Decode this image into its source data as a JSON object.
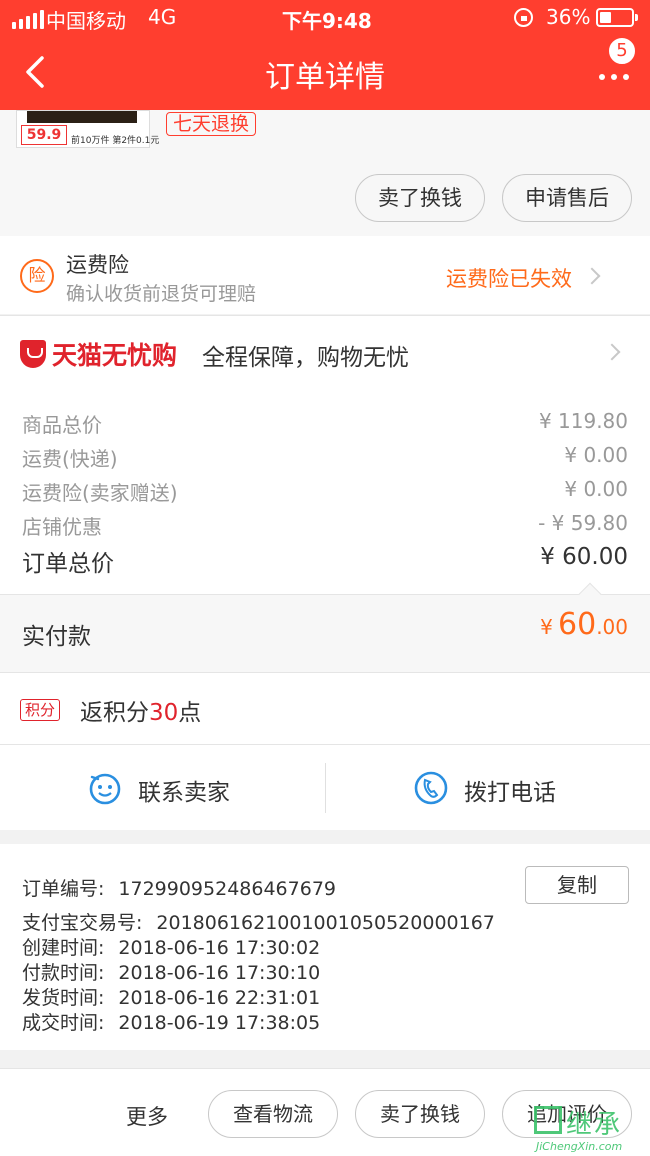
{
  "status_bar": {
    "carrier": "中国移动",
    "network": "4G",
    "time": "下午9:48",
    "battery_pct": "36%",
    "battery_level": 0.36
  },
  "header": {
    "title": "订单详情",
    "more_badge": "5"
  },
  "product": {
    "thumb_price": "59.9",
    "thumb_promo": "前10万件 第2件0.1元",
    "return_tag": "七天退换",
    "actions": [
      "卖了换钱",
      "申请售后"
    ]
  },
  "insurance": {
    "icon_char": "险",
    "title": "运费险",
    "subtitle": "确认收货前退货可理赔",
    "status": "运费险已失效"
  },
  "tmall": {
    "brand": "天猫无忧购",
    "slogan": "全程保障，购物无忧"
  },
  "price_breakdown": [
    {
      "label": "商品总价",
      "value": "¥ 119.80"
    },
    {
      "label": "运费(快递)",
      "value": "¥ 0.00"
    },
    {
      "label": "运费险(卖家赠送)",
      "value": "¥ 0.00"
    },
    {
      "label": "店铺优惠",
      "value": "- ¥ 59.80"
    }
  ],
  "order_total": {
    "label": "订单总价",
    "value": "¥ 60.00"
  },
  "paid": {
    "label": "实付款",
    "currency": "¥",
    "integer": "60",
    "decimal": ".00"
  },
  "points": {
    "tag": "积分",
    "prefix": "返积分",
    "amount": "30",
    "suffix": "点"
  },
  "contact": {
    "seller": "联系卖家",
    "phone": "拨打电话"
  },
  "order_info": {
    "copy_label": "复制",
    "rows": [
      {
        "key": "订单编号:",
        "value": "172990952486467679"
      },
      {
        "key": "支付宝交易号:",
        "value": "2018061621001001050520000167"
      },
      {
        "key": "创建时间:",
        "value": "2018-06-16 17:30:02"
      },
      {
        "key": "付款时间:",
        "value": "2018-06-16 17:30:10"
      },
      {
        "key": "发货时间:",
        "value": "2018-06-16 22:31:01"
      },
      {
        "key": "成交时间:",
        "value": "2018-06-19 17:38:05"
      }
    ]
  },
  "bottom_bar": {
    "more": "更多",
    "buttons": [
      "查看物流",
      "卖了换钱",
      "追加评价"
    ]
  },
  "watermark": {
    "text": "继承",
    "url": "JiChengXin.com"
  },
  "colors": {
    "brand": "#ff3e2f",
    "accent": "#ff6a1a",
    "tmall": "#e0232c"
  }
}
